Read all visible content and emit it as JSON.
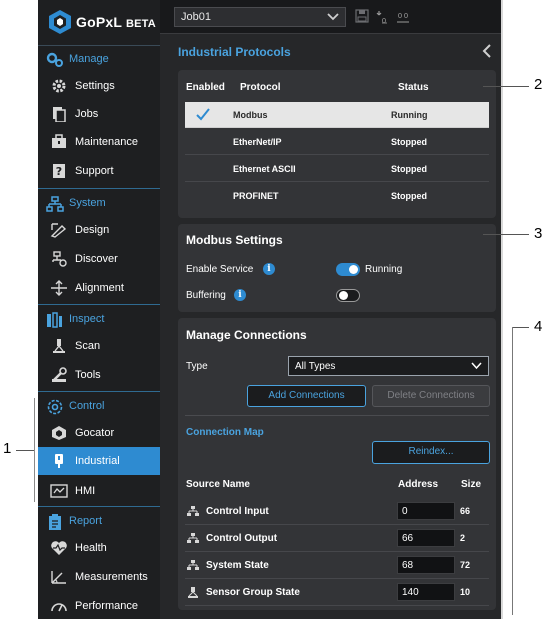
{
  "app": {
    "logo_text": "GoPxL",
    "logo_badge": "BETA"
  },
  "topbar": {
    "job_name": "Job01"
  },
  "sidebar": {
    "sections": [
      {
        "label": "Manage",
        "items": [
          "Settings",
          "Jobs",
          "Maintenance",
          "Support"
        ]
      },
      {
        "label": "System",
        "items": [
          "Design",
          "Discover",
          "Alignment"
        ]
      },
      {
        "label": "Inspect",
        "items": [
          "Scan",
          "Tools"
        ]
      },
      {
        "label": "Control",
        "items": [
          "Gocator",
          "Industrial",
          "HMI"
        ]
      },
      {
        "label": "Report",
        "items": [
          "Health",
          "Measurements",
          "Performance"
        ]
      }
    ],
    "active_item": "Industrial"
  },
  "panel": {
    "title": "Industrial Protocols"
  },
  "protocols": {
    "headers": {
      "enabled": "Enabled",
      "protocol": "Protocol",
      "status": "Status"
    },
    "rows": [
      {
        "name": "Modbus",
        "status": "Running",
        "selected": true,
        "enabled": true
      },
      {
        "name": "EtherNet/IP",
        "status": "Stopped",
        "selected": false,
        "enabled": false
      },
      {
        "name": "Ethernet ASCII",
        "status": "Stopped",
        "selected": false,
        "enabled": false
      },
      {
        "name": "PROFINET",
        "status": "Stopped",
        "selected": false,
        "enabled": false
      }
    ]
  },
  "modbus": {
    "title": "Modbus Settings",
    "enable_service_label": "Enable Service",
    "enable_service_status": "Running",
    "enable_service_on": true,
    "buffering_label": "Buffering",
    "buffering_on": false
  },
  "connections": {
    "title": "Manage Connections",
    "type_label": "Type",
    "type_value": "All Types",
    "add_button": "Add Connections",
    "delete_button": "Delete Connections",
    "map_label": "Connection Map",
    "reindex_button": "Reindex...",
    "headers": {
      "source": "Source Name",
      "address": "Address",
      "size": "Size"
    },
    "rows": [
      {
        "name": "Control Input",
        "address": "0",
        "size": "66",
        "icon": "network-icon"
      },
      {
        "name": "Control Output",
        "address": "66",
        "size": "2",
        "icon": "network-icon"
      },
      {
        "name": "System State",
        "address": "68",
        "size": "72",
        "icon": "network-icon"
      },
      {
        "name": "Sensor Group State",
        "address": "140",
        "size": "10",
        "icon": "sensor-icon"
      }
    ]
  },
  "callouts": [
    "1",
    "2",
    "3",
    "4"
  ],
  "colors": {
    "accent": "#2e8bd1",
    "section_text": "#4aa3df",
    "sidebar_bg": "#1e1f21",
    "panel_bg": "#262729",
    "card_bg": "#333437"
  }
}
